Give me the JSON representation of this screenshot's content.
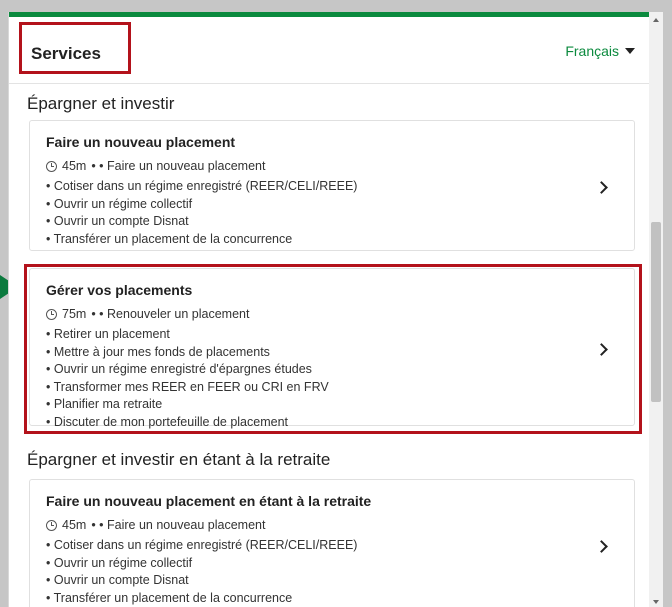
{
  "colors": {
    "accent": "#0b8a3e",
    "highlight": "#b3121b",
    "pointer": "#0b7a3e"
  },
  "header": {
    "title": "Services",
    "language": "Français"
  },
  "sections": [
    {
      "title": "Épargner et investir",
      "cards": [
        {
          "title": "Faire un nouveau placement",
          "duration": "45m",
          "meta": "• • Faire un nouveau placement",
          "items": [
            "• Cotiser dans un régime enregistré (REER/CELI/REEE)",
            "• Ouvrir un régime collectif",
            "• Ouvrir un compte Disnat",
            "• Transférer un placement de la concurrence"
          ]
        },
        {
          "title": "Gérer vos placements",
          "duration": "75m",
          "meta": "• • Renouveler un placement",
          "items": [
            "• Retirer un placement",
            "• Mettre à jour mes fonds de placements",
            "• Ouvrir un régime enregistré d'épargnes études",
            "• Transformer mes REER en FEER ou CRI en FRV",
            "• Planifier ma retraite",
            "• Discuter de mon portefeuille de placement"
          ]
        }
      ]
    },
    {
      "title": "Épargner et investir en étant à la retraite",
      "cards": [
        {
          "title": "Faire un nouveau placement en étant à la retraite",
          "duration": "45m",
          "meta": "• • Faire un nouveau placement",
          "items": [
            "• Cotiser dans un régime enregistré (REER/CELI/REEE)",
            "• Ouvrir un régime collectif",
            "• Ouvrir un compte Disnat",
            "• Transférer un placement de la concurrence"
          ]
        }
      ]
    }
  ]
}
